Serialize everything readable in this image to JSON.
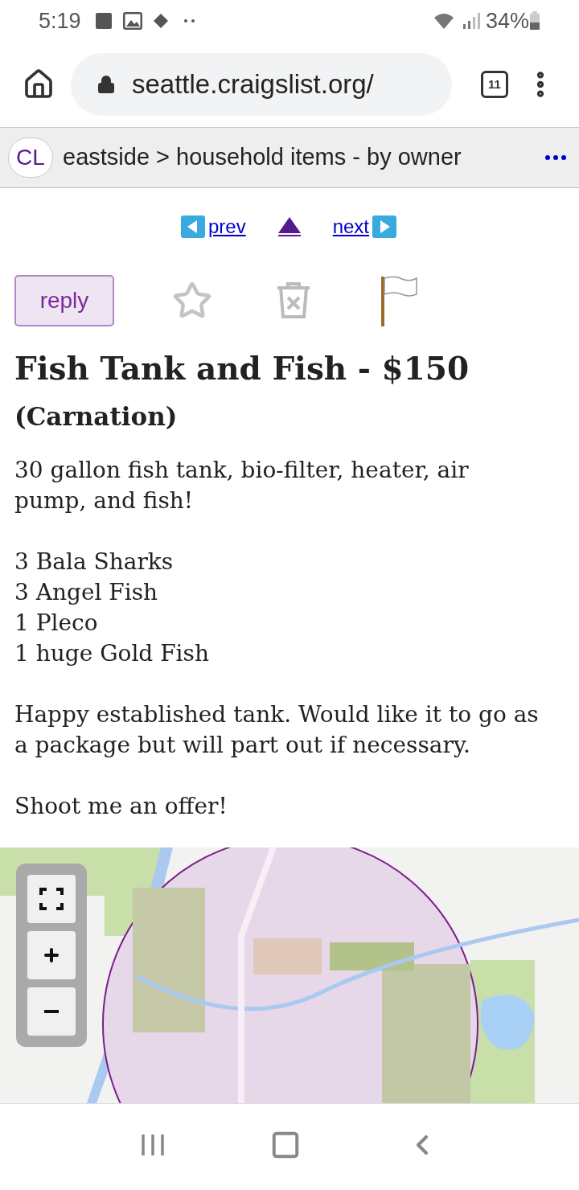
{
  "status_bar": {
    "time": "5:19",
    "battery": "34%"
  },
  "browser": {
    "url": "seattle.craigslist.org/",
    "tab_count": "11"
  },
  "breadcrumb": {
    "logo": "CL",
    "path": "eastside > household items - by owner"
  },
  "post_nav": {
    "prev": "prev",
    "next": "next"
  },
  "actions": {
    "reply": "reply"
  },
  "post": {
    "title": "Fish Tank and Fish - $150",
    "location": "(Carnation)",
    "paragraphs": [
      [
        "30 gallon fish tank, bio-filter, heater, air pump, and fish!"
      ],
      [
        "3 Bala Sharks",
        "3 Angel Fish",
        "1 Pleco",
        "1 huge Gold Fish"
      ],
      [
        "Happy established tank. Would like it to go as a package but will part out if necessary."
      ],
      [
        "Shoot me an offer!"
      ]
    ]
  }
}
